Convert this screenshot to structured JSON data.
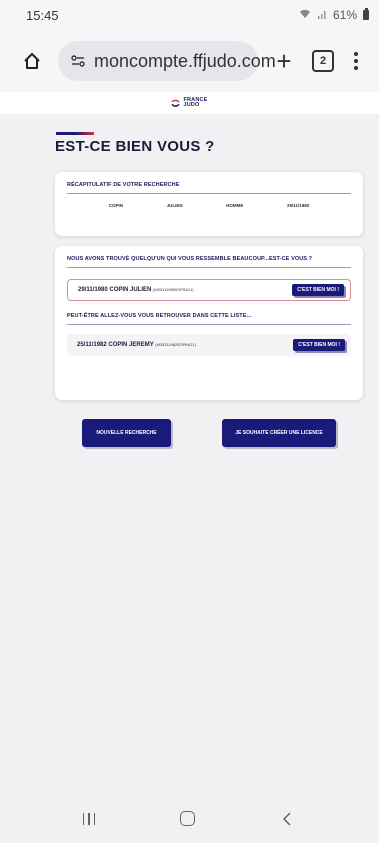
{
  "status_bar": {
    "time": "15:45",
    "battery_level": "61%",
    "icons": [
      "wifi-icon",
      "signal-icon",
      "battery-icon"
    ]
  },
  "browser": {
    "url": "moncompte.ffjudo.com",
    "tabs_count": "2",
    "icons": [
      "home-icon",
      "site-settings-icon",
      "plus-icon",
      "tabs-icon",
      "more-icon"
    ]
  },
  "header": {
    "logo_line1": "FRANCE",
    "logo_line2": "JUDO"
  },
  "page": {
    "title": "EST-CE BIEN VOUS ?"
  },
  "summary": {
    "heading": "RÉCAPITULATIF DE VOTRE RECHERCHE",
    "nom": "COPIN",
    "prenom": "JULIEN",
    "sexe": "HOMME",
    "date": "29/11/1980"
  },
  "results": {
    "match_heading": "NOUS AVONS TROUVÉ QUELQU'UN QUI VOUS RESSEMBLE BEAUCOUP...EST-CE VOUS ?",
    "match": {
      "name": "29/11/1980 COPIN JULIEN",
      "code": "(M291119800OPINO1)",
      "button": "C'EST BIEN MOI !"
    },
    "alt_heading": "PEUT-ÊTRE ALLEZ-VOUS VOUS RETROUVER DANS CETTE LISTE...",
    "alternatives": [
      {
        "name": "25/11/1982 COPIN JEREMY",
        "code": "(M251119820OPINO1)",
        "button": "C'EST BIEN MOI !"
      }
    ]
  },
  "actions": {
    "new_search": "NOUVELLE RECHERCHE",
    "create_licence": "JE SOUHAITE CRÉER UNE LICENCE"
  },
  "colors": {
    "primary": "#1a1a7a",
    "accent_red": "#d8324a",
    "background": "#f1f1f3"
  }
}
